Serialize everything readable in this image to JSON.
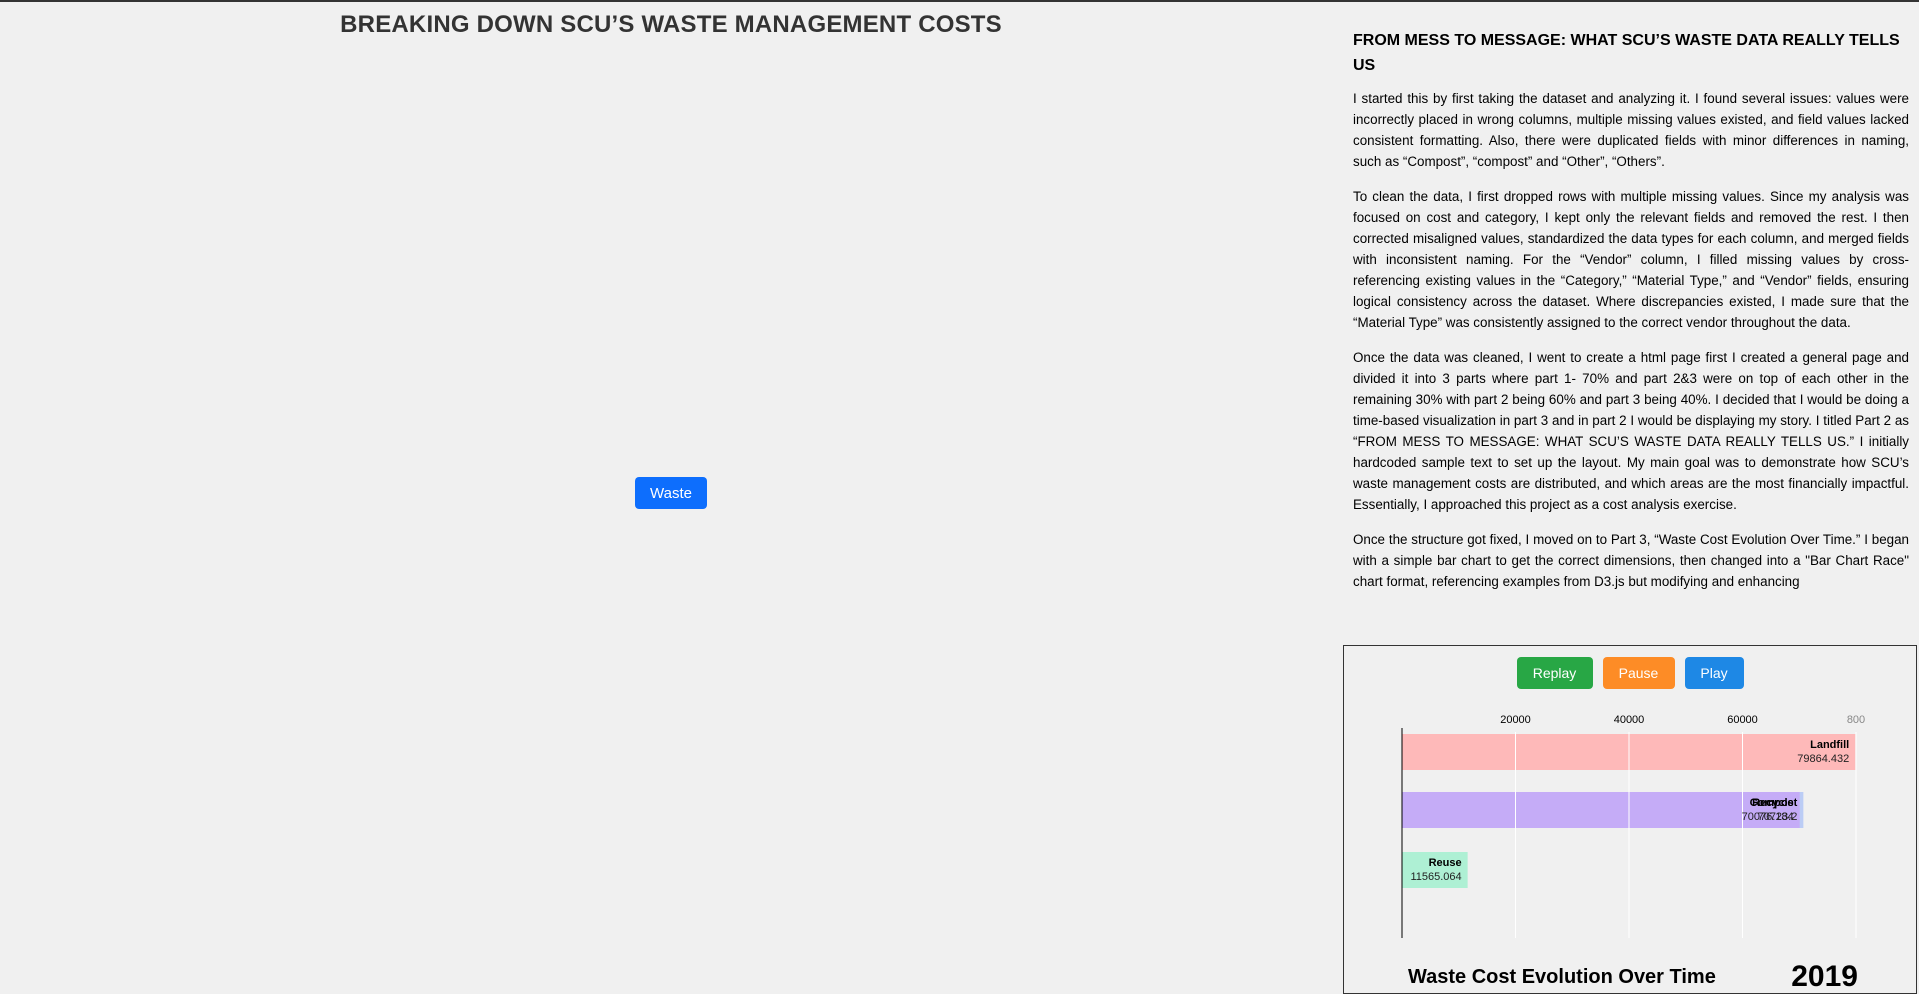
{
  "header": {
    "title": "BREAKING DOWN SCU’S WASTE MANAGEMENT COSTS"
  },
  "left": {
    "waste_button_label": "Waste"
  },
  "story": {
    "title": "FROM MESS TO MESSAGE: WHAT SCU’S WASTE DATA REALLY TELLS US",
    "paragraphs": [
      "I started this by first taking the dataset and analyzing it. I found several issues: values were incorrectly placed in wrong columns, multiple missing values existed, and field values lacked consistent formatting. Also, there were duplicated fields with minor differences in naming, such as “Compost”, “compost” and “Other”, “Others”.",
      "To clean the data, I first dropped rows with multiple missing values. Since my analysis was focused on cost and category, I kept only the relevant fields and removed the rest. I then corrected misaligned values, standardized the data types for each column, and merged fields with inconsistent naming. For the “Vendor” column, I filled missing values by cross-referencing existing values in the “Category,” “Material Type,” and “Vendor” fields, ensuring logical consistency across the dataset. Where discrepancies existed, I made sure that the “Material Type” was consistently assigned to the correct vendor throughout the data.",
      "Once the data was cleaned, I went to create a html page first I created a general page and divided it into 3 parts where part 1- 70% and part 2&3 were on top of each other in the remaining 30% with part 2 being 60% and part 3 being 40%. I decided that I would be doing a time-based visualization in part 3 and in part 2 I would be displaying my story. I titled Part 2 as “FROM MESS TO MESSAGE: WHAT SCU’S WASTE DATA REALLY TELLS US.” I initially hardcoded sample text to set up the layout. My main goal was to demonstrate how SCU’s waste management costs are distributed, and which areas are the most financially impactful. Essentially, I approached this project as a cost analysis exercise.",
      "Once the structure got fixed, I moved on to Part 3, “Waste Cost Evolution Over Time.” I began with a simple bar chart to get the correct dimensions, then changed into a \"Bar Chart Race\" chart format, referencing examples from D3.js but modifying and enhancing"
    ]
  },
  "controls": {
    "replay_label": "Replay",
    "pause_label": "Pause",
    "play_label": "Play"
  },
  "chart_data": {
    "type": "bar",
    "title": "Waste Cost Evolution Over Time",
    "year": "2019",
    "orientation": "horizontal",
    "xlim": [
      0,
      80000
    ],
    "x_ticks": [
      20000,
      40000,
      60000,
      80000
    ],
    "x_tick_labels": [
      "20000",
      "40000",
      "60000",
      "800"
    ],
    "grid": true,
    "bars": [
      {
        "name": "Landfill",
        "value": 79864.432,
        "value_label": "79864.432",
        "color": "#ffb3b3",
        "rank": 0
      },
      {
        "name": "Compost",
        "value": 70723.2,
        "value_label": "70723.2",
        "color": "#b5c8f5",
        "rank": 1
      },
      {
        "name": "Recycle",
        "value": 70076.184,
        "value_label": "70076.184",
        "color": "#c6a9f7",
        "rank": 1
      },
      {
        "name": "Reuse",
        "value": 11565.064,
        "value_label": "11565.064",
        "color": "#a6f0d0",
        "rank": 2
      }
    ]
  }
}
